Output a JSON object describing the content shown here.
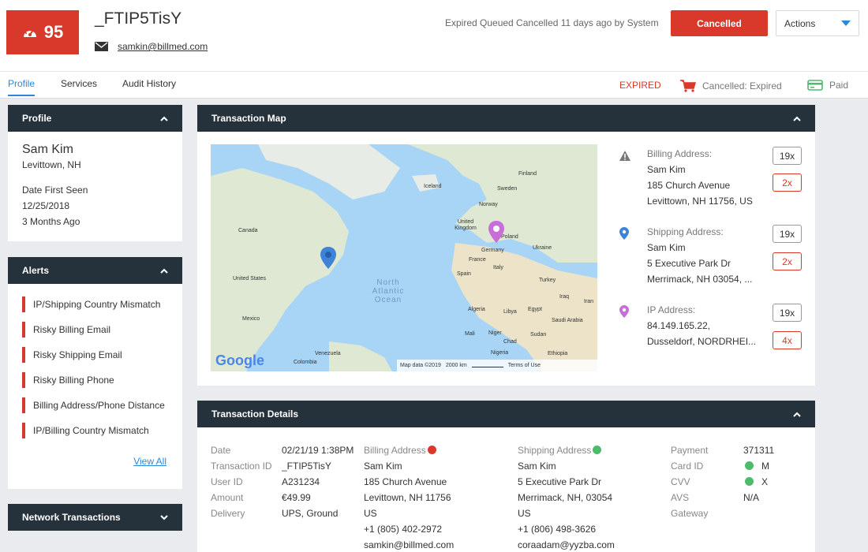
{
  "header": {
    "score": "95",
    "transaction_id": "_FTIP5TisY",
    "email": "samkin@billmed.com",
    "status_text": "Expired Queued Cancelled 11 days ago by System",
    "cancel_button": "Cancelled",
    "actions_button": "Actions"
  },
  "tabs": [
    {
      "label": "Profile"
    },
    {
      "label": "Services"
    },
    {
      "label": "Audit History"
    }
  ],
  "tab_status": {
    "expired": "EXPIRED",
    "cancelled": "Cancelled: Expired",
    "paid": "Paid"
  },
  "colors": {
    "accent_red": "#d9392b",
    "panel_header": "#25313b",
    "link_blue": "#2b88d8",
    "green": "#4cbb6c",
    "purple_pin": "#c86ed8"
  },
  "profile": {
    "title": "Profile",
    "name": "Sam Kim",
    "location": "Levittown, NH",
    "first_seen_label": "Date First Seen",
    "first_seen_date": "12/25/2018",
    "first_seen_ago": "3 Months Ago"
  },
  "alerts": {
    "title": "Alerts",
    "items": [
      "IP/Shipping Country Mismatch",
      "Risky Billing Email",
      "Risky Shipping Email",
      "Risky Billing Phone",
      "Billing Address/Phone Distance",
      "IP/Billing Country Mismatch"
    ],
    "view_all": "View All"
  },
  "network": {
    "title": "Network Transactions"
  },
  "map": {
    "title": "Transaction Map",
    "labels": {
      "canada": "Canada",
      "united_states": "United States",
      "mexico": "Mexico",
      "venezuela": "Venezuela",
      "colombia": "Colombia",
      "iceland": "Iceland",
      "finland": "Finland",
      "sweden": "Sweden",
      "norway": "Norway",
      "uk": "United Kingdom",
      "poland": "Poland",
      "germany": "Germany",
      "ukraine": "Ukraine",
      "france": "France",
      "spain": "Spain",
      "italy": "Italy",
      "turkey": "Turkey",
      "iraq": "Iraq",
      "iran": "Iran",
      "algeria": "Algeria",
      "libya": "Libya",
      "egypt": "Egypt",
      "saudi": "Saudi Arabia",
      "mali": "Mali",
      "niger": "Niger",
      "chad": "Chad",
      "sudan": "Sudan",
      "nigeria": "Nigeria",
      "ethiopia": "Ethiopia",
      "ocean1": "North",
      "ocean2": "Atlantic",
      "ocean3": "Ocean"
    },
    "google": "Google",
    "attribution": "Map data ©2019",
    "scale": "2000 km",
    "terms": "Terms of Use"
  },
  "addresses": [
    {
      "label": "Billing Address:",
      "lines": [
        "Sam Kim",
        "185 Church Avenue",
        "Levittown, NH 11756, US"
      ],
      "count_a": "19x",
      "count_b": "2x",
      "icon": "warning-icon"
    },
    {
      "label": "Shipping Address:",
      "lines": [
        "Sam Kim",
        "5 Executive Park Dr",
        "Merrimack, NH 03054, ..."
      ],
      "count_a": "19x",
      "count_b": "2x",
      "icon": "location-pin-icon"
    },
    {
      "label": "IP Address:",
      "lines": [
        "84.149.165.22,",
        "Dusseldorf, NORDRHEI..."
      ],
      "count_a": "19x",
      "count_b": "4x",
      "icon": "location-pin-icon"
    }
  ],
  "details": {
    "title": "Transaction Details",
    "labels": [
      "Date",
      "Transaction ID",
      "User ID",
      "Amount",
      "Delivery"
    ],
    "values": [
      "02/21/19 1:38PM",
      "_FTIP5TisY",
      "A231234",
      "€49.99",
      "UPS, Ground"
    ],
    "billing_title": "Billing Address",
    "billing": [
      "Sam Kim",
      "185 Church Avenue",
      "Levittown, NH 11756",
      "US",
      "+1 (805) 402-2972",
      "samkin@billmed.com"
    ],
    "shipping_title": "Shipping Address",
    "shipping": [
      "Sam Kim",
      "5 Executive Park Dr",
      "Merrimack, NH, 03054",
      "US",
      "+1 (806) 498-3626",
      "coraadam@yyzba.com"
    ],
    "payment_labels": [
      "Payment",
      "Card ID",
      "CVV",
      "AVS",
      "Gateway"
    ],
    "payment_values": [
      "",
      "371311",
      "M",
      "X",
      "N/A"
    ]
  }
}
